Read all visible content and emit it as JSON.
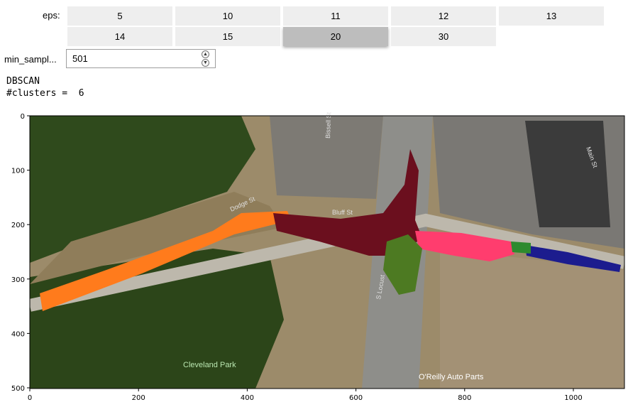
{
  "eps": {
    "label": "eps:",
    "options": [
      "5",
      "10",
      "11",
      "12",
      "13",
      "14",
      "15",
      "20",
      "30"
    ],
    "selected": "20"
  },
  "min_samples": {
    "label": "min_sampl...",
    "value": "501"
  },
  "output": {
    "line1": "DBSCAN",
    "line2": "#clusters =  6"
  },
  "plot": {
    "x_ticks": [
      "0",
      "200",
      "400",
      "600",
      "800",
      "1000"
    ],
    "y_ticks": [
      "0",
      "100",
      "200",
      "300",
      "400",
      "500"
    ],
    "map_labels": {
      "park": "Cleveland Park",
      "shop": "O'Reilly Auto Parts",
      "street_bluff": "Bluff St",
      "street_dodge": "Dodge St",
      "street_locust": "S Locust",
      "street_main": "Main St",
      "street_bissell": "Bissell St"
    },
    "cluster_colors": [
      "#ff7b1c",
      "#6b0f1e",
      "#ff3d6e",
      "#4d7a22",
      "#1c1c8e",
      "#2e8a2e"
    ]
  }
}
